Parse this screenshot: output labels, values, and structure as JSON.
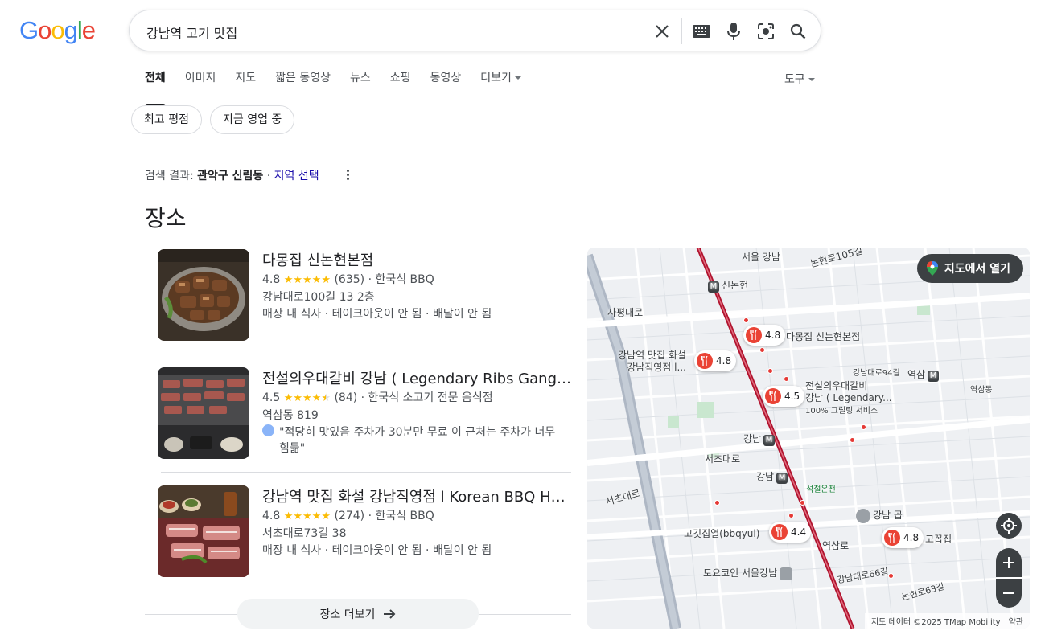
{
  "header": {
    "logo_letters": [
      {
        "ch": "G",
        "color": "#4285F4"
      },
      {
        "ch": "o",
        "color": "#EA4335"
      },
      {
        "ch": "o",
        "color": "#FBBC05"
      },
      {
        "ch": "g",
        "color": "#4285F4"
      },
      {
        "ch": "l",
        "color": "#34A853"
      },
      {
        "ch": "e",
        "color": "#EA4335"
      }
    ],
    "search": {
      "query": "강남역 고기 맛집"
    },
    "icons": [
      "close-icon",
      "keyboard-icon",
      "microphone-icon",
      "lens-icon",
      "search-icon"
    ]
  },
  "tabs": [
    {
      "label": "전체",
      "active": true
    },
    {
      "label": "이미지"
    },
    {
      "label": "지도"
    },
    {
      "label": "짧은 동영상"
    },
    {
      "label": "뉴스"
    },
    {
      "label": "쇼핑"
    },
    {
      "label": "동영상"
    },
    {
      "label": "더보기"
    }
  ],
  "tools_label": "도구",
  "chips": [
    "최고 평점",
    "지금 영업 중"
  ],
  "location": {
    "prefix": "검색 결과:",
    "place": "관악구 신림동",
    "sep": " · ",
    "change": "지역 선택"
  },
  "places_title": "장소",
  "places": [
    {
      "name": "다몽집 신논현본점",
      "rating": "4.8",
      "stars": 5,
      "reviews": "(635)",
      "category": "· 한국식 BBQ",
      "address": "강남대로100길 13 2층",
      "services": "매장 내 식사 · 테이크아웃이 안 됨 · 배달이 안 됨"
    },
    {
      "name": "전설의우대갈비 강남 ( Legendary Ribs Gangnam )",
      "rating": "4.5",
      "stars": 4.5,
      "reviews": "(84)",
      "category": "· 한국식 소고기 전문 음식점",
      "address": "역삼동 819",
      "review_quote": "\"적당히 맛있음 주차가 30분만 무료 이 근처는 주차가 너무",
      "review_quote_2": "힘듦\""
    },
    {
      "name": "강남역 맛집 화설 강남직영점 l Korean BBQ House",
      "rating": "4.8",
      "stars": 5,
      "reviews": "(274)",
      "category": "· 한국식 BBQ",
      "address": "서초대로73길 38",
      "services": "매장 내 식사 · 테이크아웃이 안 됨 · 배달이 안 됨"
    }
  ],
  "more_places_label": "장소 더보기",
  "map": {
    "open_label": "지도에서 열기",
    "attribution": "지도 데이터 ©2025 TMap Mobility",
    "terms": "약관",
    "pins": [
      {
        "rating": "4.8",
        "label": "다몽집 신논현본점"
      },
      {
        "rating": "4.8",
        "label": "강남역 맛집 화설\n강남직영점 l..."
      },
      {
        "rating": "4.5",
        "label": "전설의우대갈비\n강남 ( Legendary..."
      },
      {
        "rating": "4.4",
        "label": "고깃집열(bbqyul)"
      },
      {
        "rating": "4.8",
        "label": "고꼽집"
      }
    ],
    "labels": {
      "sinnonhyeon": "신논현",
      "gangnam1": "강남",
      "gangnam2": "강남",
      "yeoksam": "역삼",
      "seoul_gangnam": "서울 강남",
      "gangnam_gop": "강남 곱",
      "toyocoin": "토요코인 서울강남",
      "service": "100% 그릴링 서비스",
      "sapyeongdaero": "사평대로",
      "seochodaero": "서초대로",
      "seochodaero2": "서초대로",
      "yeoksamro": "역삼로",
      "seokjeol": "석절온천",
      "nonhyeon105": "논현로105길",
      "gangnamdaero94": "강남대로94길",
      "gangnamdaero66": "강남대로66길",
      "nonhyeon63": "논현로63길",
      "yeoksamdong": "역삼동"
    }
  }
}
